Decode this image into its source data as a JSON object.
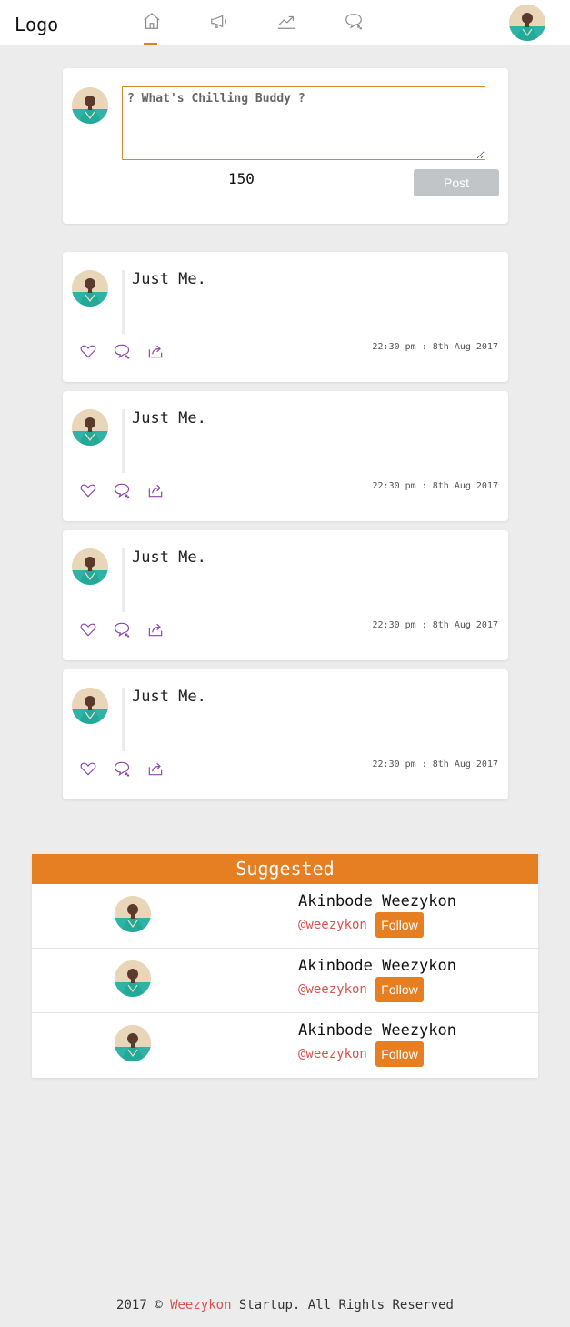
{
  "header": {
    "logo": "Logo",
    "nav": [
      {
        "icon": "home-icon",
        "active": true
      },
      {
        "icon": "megaphone-icon",
        "active": false
      },
      {
        "icon": "trending-icon",
        "active": false
      },
      {
        "icon": "comment-icon",
        "active": false
      }
    ],
    "accent_color": "#e67e22"
  },
  "compose": {
    "placeholder": "? What's Chilling Buddy ?",
    "char_count": "150",
    "post_label": "Post"
  },
  "posts": [
    {
      "text": "Just Me.",
      "timestamp": "22:30 pm : 8th Aug 2017"
    },
    {
      "text": "Just Me.",
      "timestamp": "22:30 pm : 8th Aug 2017"
    },
    {
      "text": "Just Me.",
      "timestamp": "22:30 pm : 8th Aug 2017"
    },
    {
      "text": "Just Me.",
      "timestamp": "22:30 pm : 8th Aug 2017"
    }
  ],
  "suggested": {
    "title": "Suggested",
    "users": [
      {
        "name": "Akinbode Weezykon",
        "handle": "@weezykon",
        "follow_label": "Follow"
      },
      {
        "name": "Akinbode Weezykon",
        "handle": "@weezykon",
        "follow_label": "Follow"
      },
      {
        "name": "Akinbode Weezykon",
        "handle": "@weezykon",
        "follow_label": "Follow"
      }
    ]
  },
  "footer": {
    "prefix": "2017 © ",
    "brand": "Weezykon",
    "suffix": " Startup. All Rights Reserved"
  }
}
